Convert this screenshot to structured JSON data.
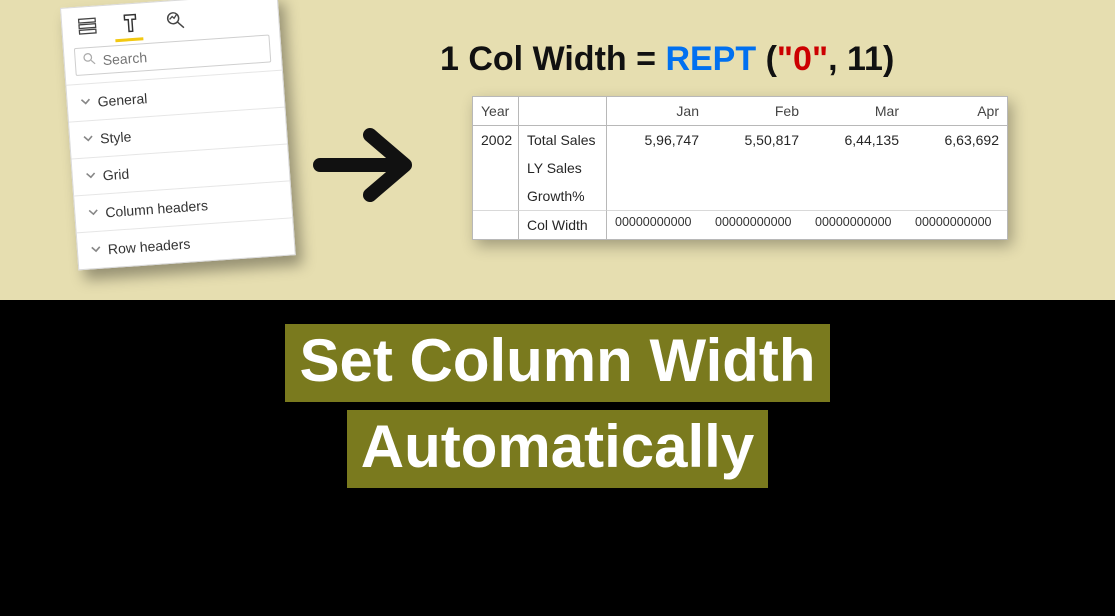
{
  "format_pane": {
    "search_placeholder": "Search",
    "search_value": "",
    "sections": [
      "General",
      "Style",
      "Grid",
      "Column headers",
      "Row headers"
    ]
  },
  "formula": {
    "lhs": "1 Col Width",
    "eq": "=",
    "fn": "REPT",
    "open": "(",
    "q1": "\"",
    "arg_str": "0",
    "q2": "\"",
    "comma": ",",
    "arg_num": "11",
    "close": ")"
  },
  "headline": {
    "line1": "Set Column Width",
    "line2": "Automatically"
  },
  "chart_data": {
    "type": "table",
    "title": "",
    "columns": [
      "Year",
      "",
      "Jan",
      "Feb",
      "Mar",
      "Apr"
    ],
    "rows": [
      {
        "year": "2002",
        "label": "Total Sales",
        "Jan": "5,96,747",
        "Feb": "5,50,817",
        "Mar": "6,44,135",
        "Apr": "6,63,692"
      },
      {
        "year": "",
        "label": "LY Sales",
        "Jan": "",
        "Feb": "",
        "Mar": "",
        "Apr": ""
      },
      {
        "year": "",
        "label": "Growth%",
        "Jan": "",
        "Feb": "",
        "Mar": "",
        "Apr": ""
      },
      {
        "year": "",
        "label": "Col Width",
        "Jan": "00000000000",
        "Feb": "00000000000",
        "Mar": "00000000000",
        "Apr": "00000000000"
      }
    ]
  }
}
